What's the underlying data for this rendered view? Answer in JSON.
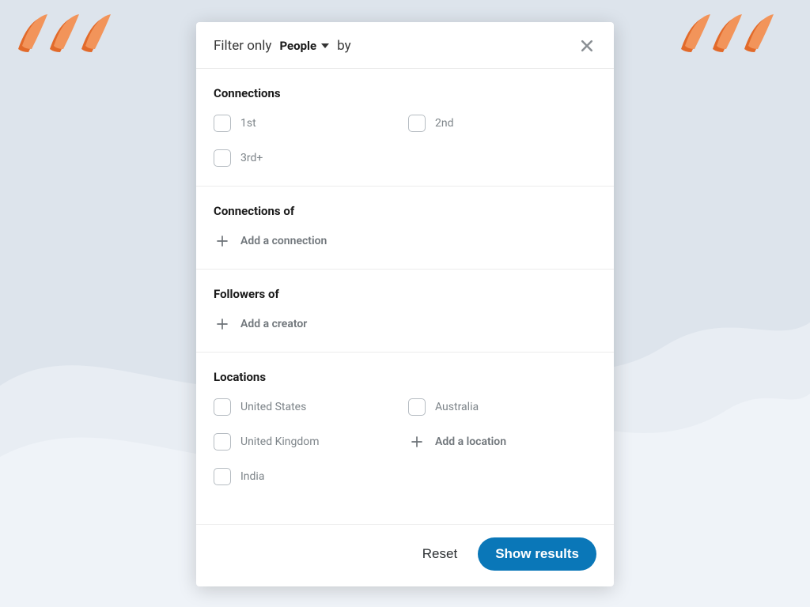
{
  "header": {
    "prefix": "Filter only",
    "dropdown_value": "People",
    "suffix": "by"
  },
  "sections": {
    "connections": {
      "title": "Connections",
      "options": [
        "1st",
        "2nd",
        "3rd+"
      ]
    },
    "connections_of": {
      "title": "Connections of",
      "add_label": "Add a connection"
    },
    "followers_of": {
      "title": "Followers of",
      "add_label": "Add a creator"
    },
    "locations": {
      "title": "Locations",
      "options": [
        "United States",
        "Australia",
        "United Kingdom",
        "India"
      ],
      "add_label": "Add a location"
    }
  },
  "footer": {
    "reset_label": "Reset",
    "submit_label": "Show results"
  },
  "colors": {
    "primary": "#0a77b8",
    "swoosh_light": "#f08a4b",
    "swoosh_dark": "#e26a2a"
  }
}
